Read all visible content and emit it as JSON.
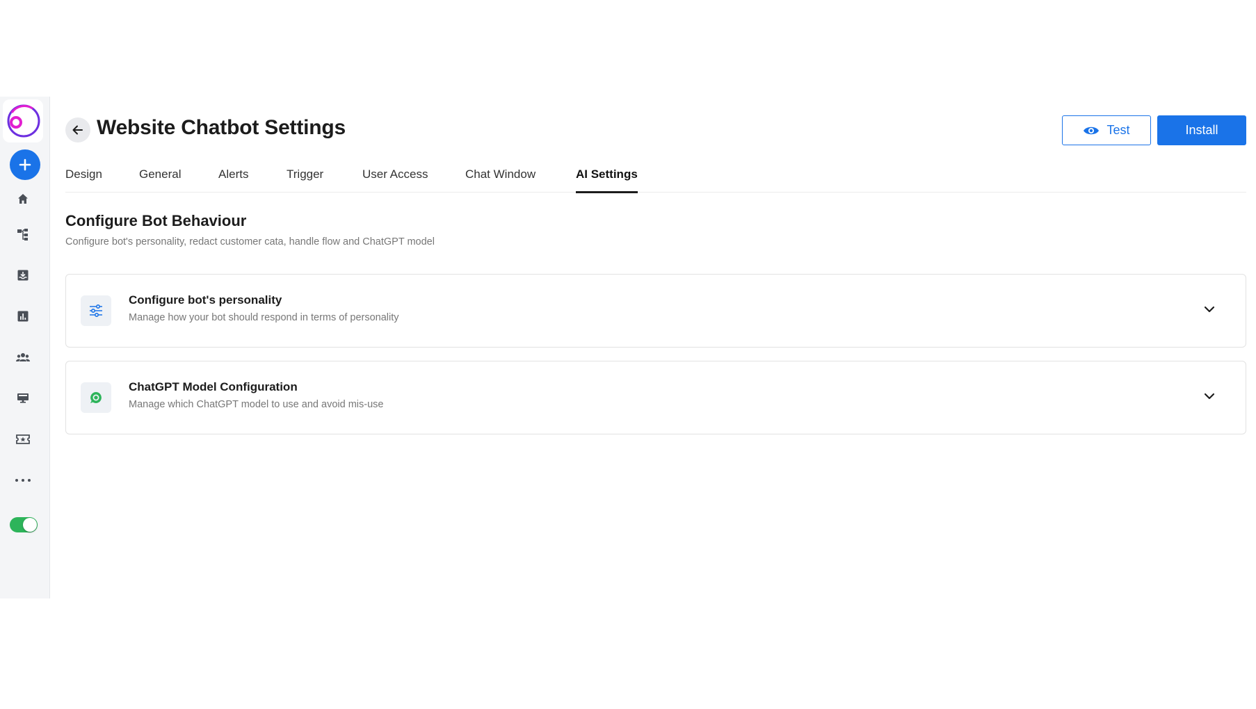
{
  "sidebar": {
    "logo": "o-logo-icon",
    "add_button": "plus-icon",
    "items": [
      {
        "name": "home",
        "icon": "home-icon"
      },
      {
        "name": "flows",
        "icon": "flow-icon"
      },
      {
        "name": "inbox",
        "icon": "inbox-icon"
      },
      {
        "name": "analytics",
        "icon": "chart-icon"
      },
      {
        "name": "contacts",
        "icon": "people-icon"
      },
      {
        "name": "channels",
        "icon": "monitor-icon"
      },
      {
        "name": "tickets",
        "icon": "ticket-icon"
      },
      {
        "name": "more",
        "icon": "more-icon"
      }
    ],
    "toggle_on": true
  },
  "header": {
    "title": "Website Chatbot Settings",
    "test_label": "Test",
    "install_label": "Install"
  },
  "tabs": [
    {
      "label": "Design"
    },
    {
      "label": "General"
    },
    {
      "label": "Alerts"
    },
    {
      "label": "Trigger"
    },
    {
      "label": "User Access"
    },
    {
      "label": "Chat Window"
    },
    {
      "label": "AI Settings",
      "active": true
    }
  ],
  "section": {
    "title": "Configure Bot Behaviour",
    "subtitle": "Configure bot's personality, redact customer cata, handle flow and ChatGPT model"
  },
  "cards": [
    {
      "title": "Configure bot's personality",
      "description": "Manage how your bot should respond in terms of personality",
      "icon": "sliders-icon"
    },
    {
      "title": "ChatGPT Model Configuration",
      "description": "Manage which ChatGPT model to use and avoid mis-use",
      "icon": "chatgpt-icon"
    }
  ],
  "colors": {
    "primary": "#1a73e8",
    "toggle": "#2db45a",
    "logo_magenta": "#e21fd0",
    "logo_purple": "#6d2fe0"
  }
}
